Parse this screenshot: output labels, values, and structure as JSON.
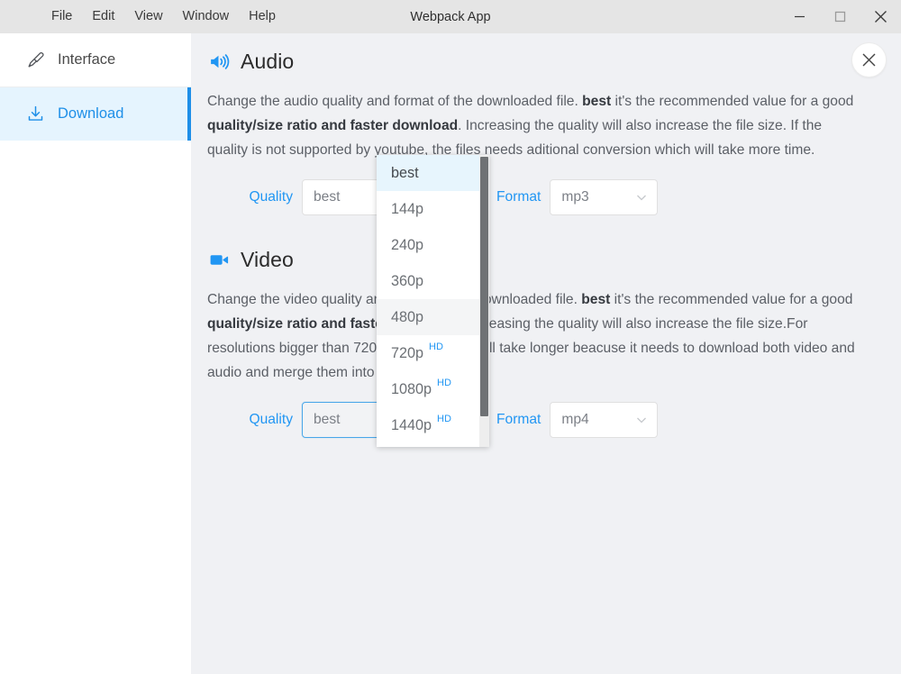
{
  "window": {
    "title": "Webpack App",
    "menu": [
      "File",
      "Edit",
      "View",
      "Window",
      "Help"
    ],
    "controls": {
      "minimize": "minimize",
      "maximize": "maximize",
      "close": "close"
    }
  },
  "sidebar": {
    "items": [
      {
        "label": "Interface",
        "icon": "highlighter-icon",
        "active": false
      },
      {
        "label": "Download",
        "icon": "download-icon",
        "active": true
      }
    ]
  },
  "content": {
    "close_label": "×",
    "audio": {
      "title": "Audio",
      "icon": "speaker-icon",
      "description": {
        "p1": "Change the audio quality and format of the downloaded file. ",
        "b1": "best",
        "p2": " it's the recommended value for a good ",
        "b2": "quality/size ratio and faster download",
        "p3": ". Increasing the quality will also increase the file size. If the quality is not supported by youtube, the files needs aditional conversion which will take more time."
      },
      "quality_label": "Quality",
      "quality_value": "best",
      "format_label": "Format",
      "format_value": "mp3"
    },
    "video": {
      "title": "Video",
      "icon": "video-camera-icon",
      "description": {
        "p1": "Change the video quality and format of the downloaded file. ",
        "b1": "best",
        "p2": " it's the recommended value for a good ",
        "b2": "quality/size ratio and faster download",
        "p3": ". Increasing the quality will also increase the file size.For resolutions bigger than 720p the download will take longer beacuse it needs to download both video and audio and merge them into a single file."
      },
      "quality_label": "Quality",
      "quality_value": "best",
      "format_label": "Format",
      "format_value": "mp4"
    }
  },
  "dropdown": {
    "open": true,
    "items": [
      {
        "label": "best",
        "badge": "",
        "state": "selected"
      },
      {
        "label": "144p",
        "badge": "",
        "state": "normal"
      },
      {
        "label": "240p",
        "badge": "",
        "state": "normal"
      },
      {
        "label": "360p",
        "badge": "",
        "state": "normal"
      },
      {
        "label": "480p",
        "badge": "",
        "state": "hovered"
      },
      {
        "label": "720p",
        "badge": "HD",
        "state": "normal"
      },
      {
        "label": "1080p",
        "badge": "HD",
        "state": "normal"
      },
      {
        "label": "1440p",
        "badge": "HD",
        "state": "normal"
      }
    ]
  },
  "colors": {
    "accent": "#2196f3",
    "titlebar": "#e5e5e5",
    "content_bg": "#f0f1f4",
    "sidebar_active_bg": "#e5f4fe",
    "dropdown_selected_bg": "#e7f5fd"
  }
}
